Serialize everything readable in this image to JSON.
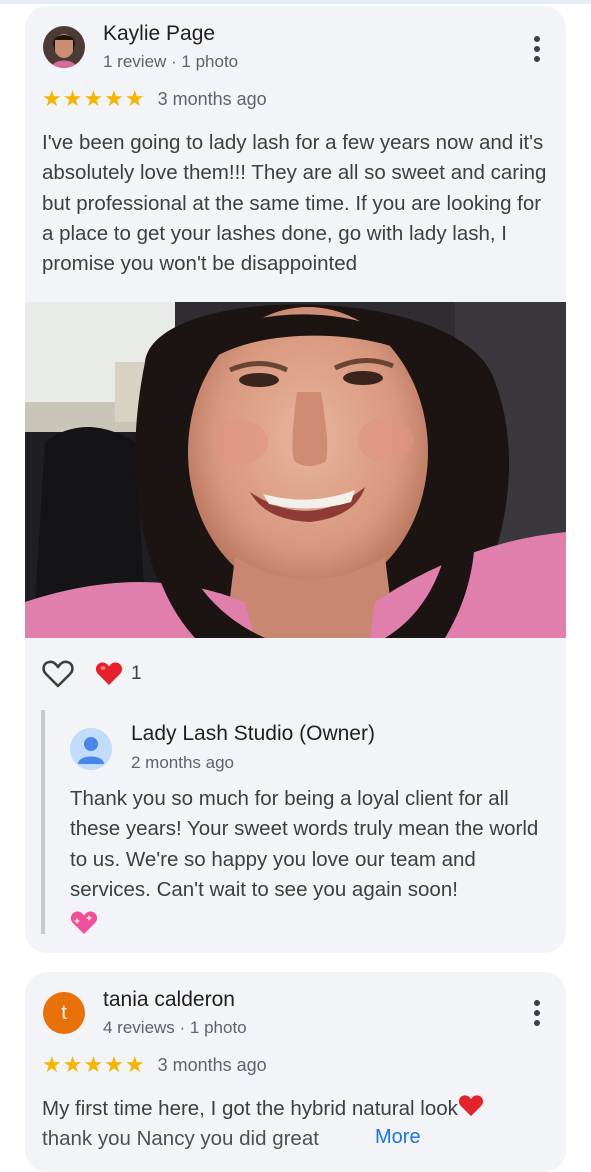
{
  "reviews": [
    {
      "author": "Kaylie Page",
      "meta": "1 review · 1 photo",
      "stars": "★★★★★",
      "ago": "3 months ago",
      "text": "I've been going to lady lash for a few years now and it's absolutely love them!!! They are all so sweet and caring but professional at the same time. If you are looking for a place to get your lashes done, go with lady lash, I promise you won't be disappointed",
      "reaction_count": "1",
      "owner_reply": {
        "name": "Lady Lash Studio (Owner)",
        "ago": "2 months ago",
        "text": "Thank you so much for being a loyal client for all these years! Your sweet words truly mean the world to us. We're so happy you love our team and services. Can't wait to see you again soon!"
      }
    },
    {
      "author": "tania calderon",
      "avatar_letter": "t",
      "meta": "4 reviews · 1 photo",
      "stars": "★★★★★",
      "ago": "3 months ago",
      "text_line1": "My first time here, I got the hybrid natural look",
      "text_line2": "thank you Nancy you did great",
      "more": "More"
    }
  ],
  "colors": {
    "star": "#f4b400",
    "card_bg": "#f3f4f7",
    "link": "#1a73e8",
    "avatar_t": "#e8710a"
  }
}
